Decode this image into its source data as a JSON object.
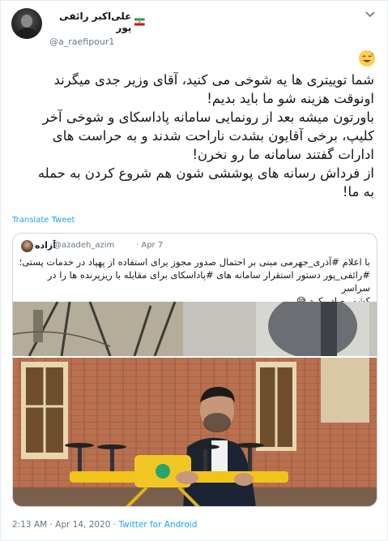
{
  "author": {
    "display_name": "علی‌اکبر رائفی پور",
    "handle": "@a_raefipour1"
  },
  "tweet": {
    "emoji": "😅",
    "lines": [
      "شما توییتری ها یه شوخی می کنید، آقای وزیر جدی میگرند",
      "اونوقت هزینه شو ما باید بدیم!",
      "باورتون میشه بعد از رونمایی سامانه پاداسکای و شوخی آخر",
      "کلیپ، برخی آقایون بشدت ناراحت شدند و به حراست های",
      "ادارات گفتند سامانه ما رو نخرن!",
      "از فرداش رسانه های پوششی شون هم شروع کردن به حمله",
      "به ما!"
    ],
    "translate_label": "Translate Tweet"
  },
  "quoted": {
    "name": "آزاده",
    "handle": "@azadeh_azim",
    "date": "· Apr 7",
    "lines": [
      "با اعلام #آذری_جهرمی مبنی بر احتمال صدور مجوز برای استفاده از پهپاد در خدمات پستی؛",
      "#رائفی_پور دستور استقرار سامانه های #پاداسکای برای مقابله با ریزپرنده ها را در سراسر",
      "کشور صادر کرد 😅"
    ]
  },
  "footer": {
    "time": "2:13 AM · Apr 14, 2020 · ",
    "source": "Twitter for Android"
  },
  "colors": {
    "link": "#1da1f2",
    "muted": "#657786",
    "border": "#ccd6dd"
  }
}
